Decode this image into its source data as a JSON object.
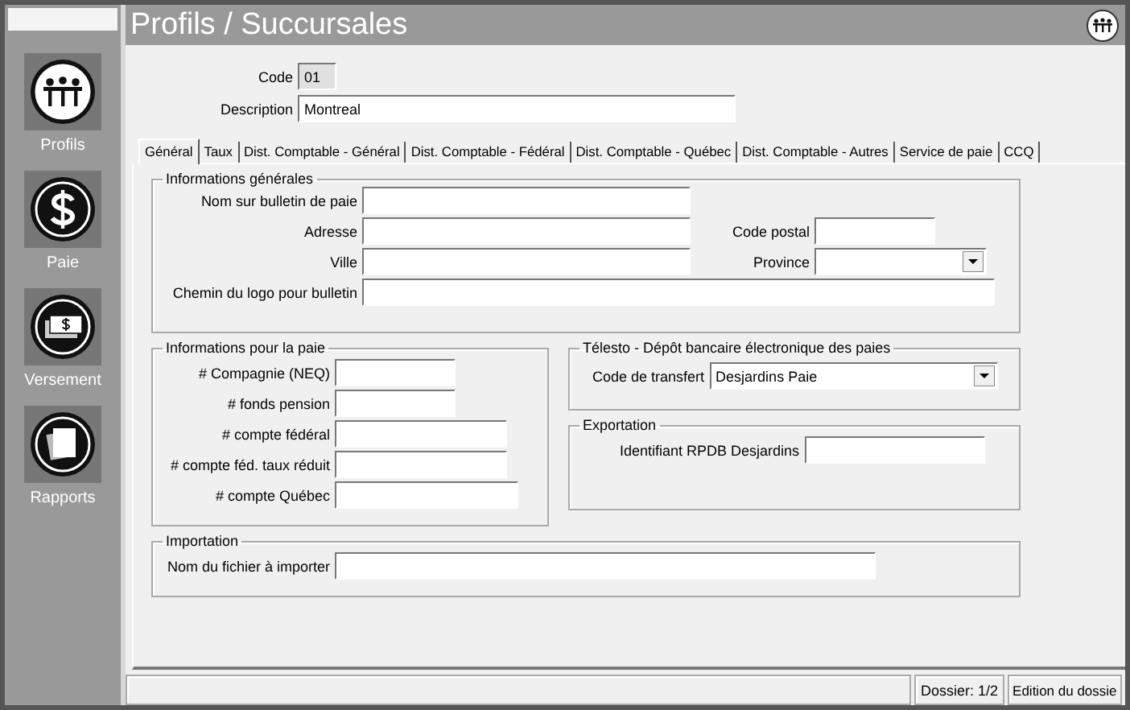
{
  "window": {
    "title": "Profils / Succursales"
  },
  "sidebar": {
    "items": [
      {
        "label": "Profils",
        "kind": "people"
      },
      {
        "label": "Paie",
        "kind": "dollar"
      },
      {
        "label": "Versement",
        "kind": "bills"
      },
      {
        "label": "Rapports",
        "kind": "pages"
      }
    ]
  },
  "record": {
    "code": {
      "label": "Code",
      "value": "01",
      "readonly": true
    },
    "description": {
      "label": "Description",
      "value": "Montreal",
      "readonly": false
    }
  },
  "tabs": [
    {
      "label": "Général",
      "selected": true
    },
    {
      "label": "Taux",
      "selected": false
    },
    {
      "label": "Dist. Comptable - Général",
      "selected": false
    },
    {
      "label": "Dist. Comptable - Fédéral",
      "selected": false
    },
    {
      "label": "Dist. Comptable - Québec",
      "selected": false
    },
    {
      "label": "Dist. Comptable - Autres",
      "selected": false
    },
    {
      "label": "Service de paie",
      "selected": false
    },
    {
      "label": "CCQ",
      "selected": false
    }
  ],
  "general": {
    "title": "Informations générales",
    "fields": [
      {
        "label": "Nom sur bulletin de paie",
        "kind": "text"
      },
      {
        "label": "Adresse",
        "kind": "text"
      },
      {
        "label": "Code postal",
        "kind": "text"
      },
      {
        "label": "Ville",
        "kind": "text"
      },
      {
        "label": "Province",
        "kind": "select"
      },
      {
        "label": "Chemin du logo pour bulletin",
        "kind": "text"
      }
    ]
  },
  "pay": {
    "title": "Informations pour la paie",
    "fields": [
      {
        "label": "# Compagnie (NEQ)"
      },
      {
        "label": "# fonds pension"
      },
      {
        "label": "# compte fédéral"
      },
      {
        "label": "# compte féd. taux réduit"
      },
      {
        "label": "# compte Québec"
      }
    ]
  },
  "telesto": {
    "title": "Télesto - Dépôt bancaire électronique des paies",
    "fields": [
      {
        "label": "Code de transfert",
        "kind": "select",
        "value": "Desjardins Paie"
      }
    ]
  },
  "export": {
    "title": "Exportation",
    "fields": [
      {
        "label": "Identifiant RPDB Desjardins"
      }
    ]
  },
  "import": {
    "title": "Importation",
    "fields": [
      {
        "label": "Nom du fichier à importer"
      }
    ]
  },
  "status_bar": {
    "items": [
      "Dossier: 1/2",
      "Edition du dossie"
    ]
  }
}
